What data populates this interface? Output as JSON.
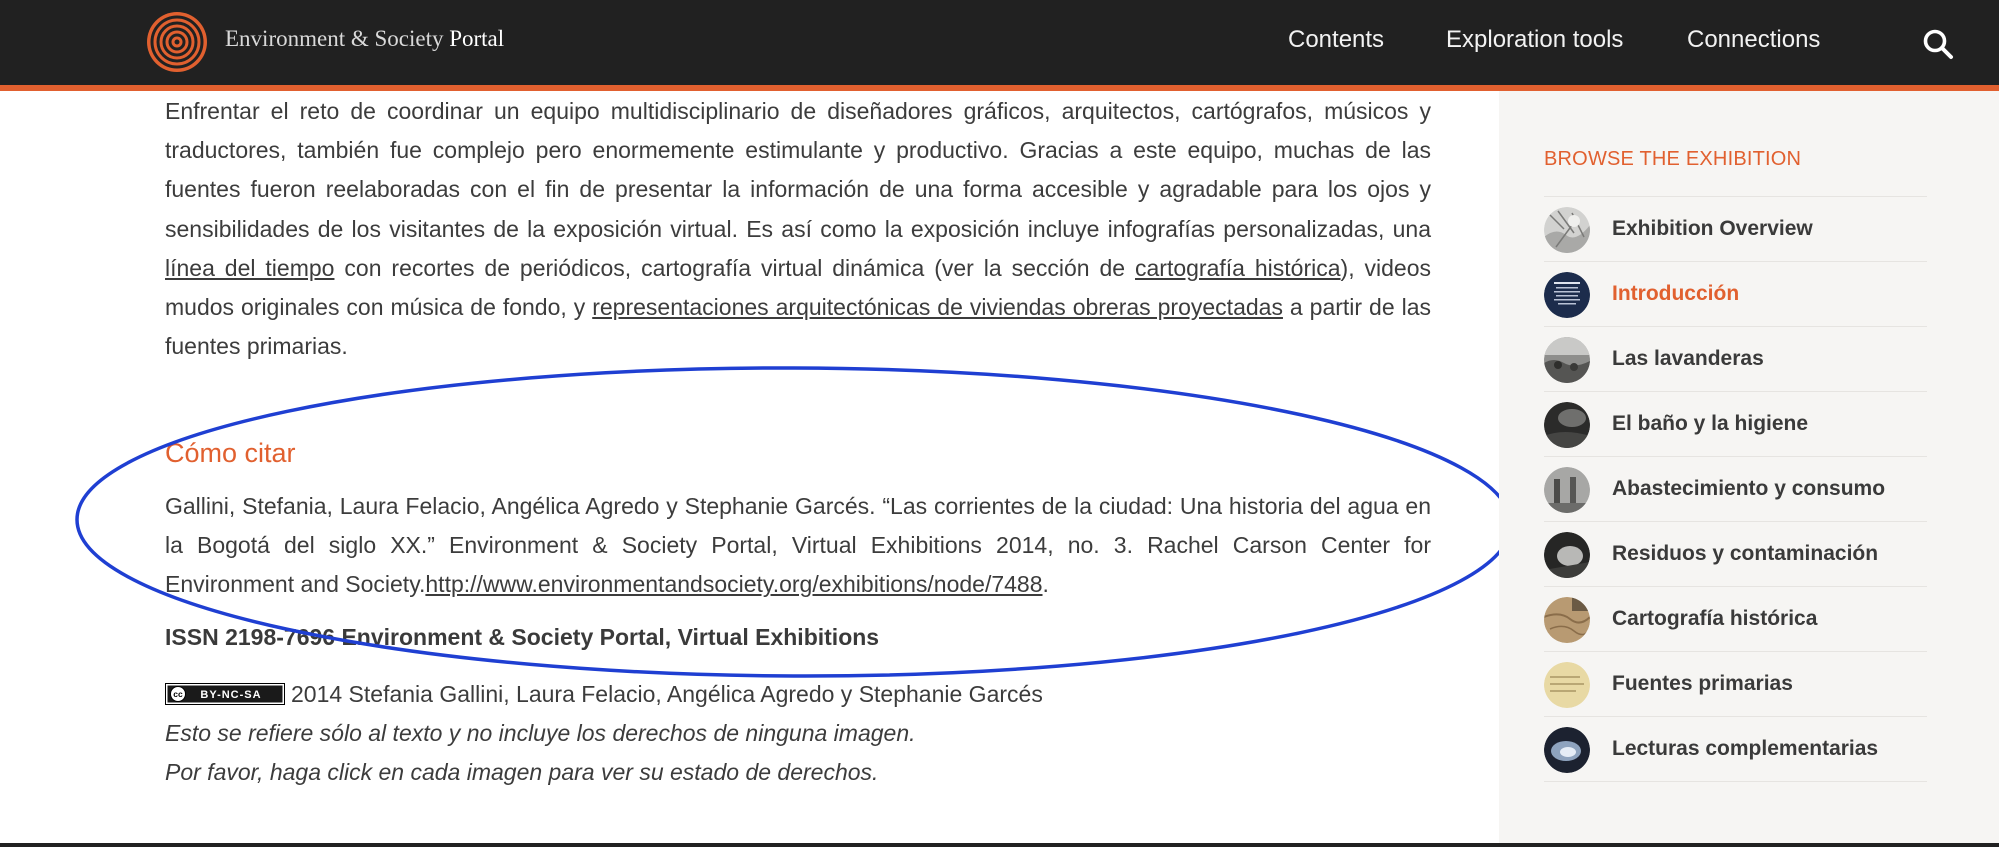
{
  "header": {
    "brand_prefix": "Environment & Society",
    "brand_suffix": "Portal",
    "nav": [
      "Contents",
      "Exploration tools",
      "Connections"
    ],
    "search_icon": "search-icon",
    "colors": {
      "bar": "#212121",
      "accent": "#e1602f"
    }
  },
  "main": {
    "paragraph": {
      "t1": "Enfrentar el reto de coordinar un equipo multidisciplinario de diseñadores gráficos, arquitectos, cartógrafos, músicos y traductores, también fue complejo pero enormemente estimulante y productivo. Gracias a este equipo, muchas de las fuentes fueron reelaboradas con el fin de presentar la información de una forma accesible y agradable para los ojos y sensibilidades de los visitantes de la exposición virtual. Es así como la exposición incluye infografías personalizadas, una ",
      "link1": "línea del tiempo",
      "t2": " con recortes de periódicos, cartografía virtual dinámica (ver la sección de ",
      "link2": "cartografía histórica",
      "t3": "), videos mudos originales con música de fondo, y ",
      "link3": "representaciones arquitectónicas de viviendas obreras proyectadas",
      "t4": " a partir de las fuentes primarias."
    },
    "cite_heading": "Cómo citar",
    "citation": {
      "text": "Gallini, Stefania, Laura Felacio, Angélica Agredo y Stephanie Garcés. “Las corrientes de la ciudad: Una historia del agua en la Bogotá del siglo XX.” Environment & Society Portal, Virtual Exhibitions 2014, no. 3. Rachel Carson Center for Environment and Society.",
      "url": "http://www.environmentandsociety.org/exhibitions/node/7488",
      "end": "."
    },
    "issn": "ISSN 2198-7696 Environment & Society Portal, Virtual Exhibitions",
    "license": {
      "badge": "BY-NC-SA",
      "text": "2014 Stefania Gallini, Laura Felacio, Angélica Agredo y Stephanie Garcés"
    },
    "note1": "Esto se refiere sólo al texto y no incluye los derechos de ninguna imagen.",
    "note2": "Por favor, haga click en cada imagen para ver su estado de derechos."
  },
  "sidebar": {
    "heading": "BROWSE THE EXHIBITION",
    "items": [
      {
        "label": "Exhibition Overview"
      },
      {
        "label": "Introducción",
        "active": true
      },
      {
        "label": "Las lavanderas"
      },
      {
        "label": "El baño y la higiene"
      },
      {
        "label": "Abastecimiento y consumo"
      },
      {
        "label": "Residuos y contaminación"
      },
      {
        "label": "Cartografía histórica"
      },
      {
        "label": "Fuentes primarias"
      },
      {
        "label": "Lecturas complementarias"
      }
    ]
  }
}
